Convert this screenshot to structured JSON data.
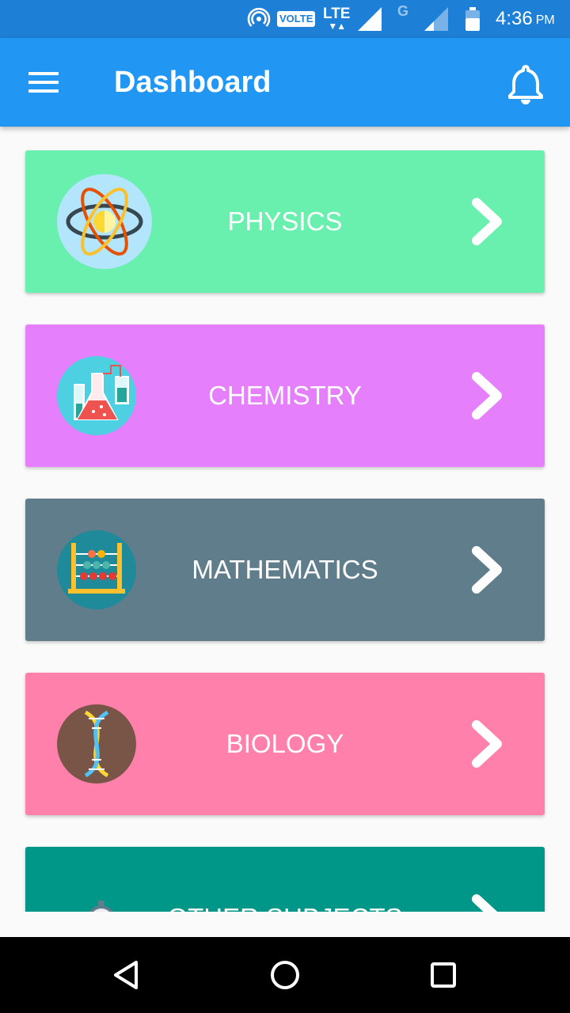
{
  "status_bar": {
    "volte_label": "VOLTE",
    "lte_label": "LTE",
    "g_label": "G",
    "time": "4:36",
    "ampm": "PM",
    "icons": [
      "hotspot-icon",
      "volte-icon",
      "lte-data-icon",
      "signal-icon",
      "signal-weak-icon",
      "battery-icon"
    ]
  },
  "app_bar": {
    "title": "Dashboard",
    "menu_icon": "hamburger-menu-icon",
    "notification_icon": "bell-icon",
    "color": "#2196f3"
  },
  "subjects": [
    {
      "label": "PHYSICS",
      "color": "#69f0ae",
      "icon": "atom-icon"
    },
    {
      "label": "CHEMISTRY",
      "color": "#e57ffb",
      "icon": "chemistry-flask-icon"
    },
    {
      "label": "MATHEMATICS",
      "color": "#607d8b",
      "icon": "abacus-icon"
    },
    {
      "label": "BIOLOGY",
      "color": "#ff80ab",
      "icon": "dna-icon"
    },
    {
      "label": "OTHER SUBJECTS",
      "color": "#009688",
      "icon": "clipboard-stopwatch-icon"
    }
  ],
  "nav_bar": {
    "icons": [
      "back-icon",
      "home-icon",
      "recents-icon"
    ]
  }
}
